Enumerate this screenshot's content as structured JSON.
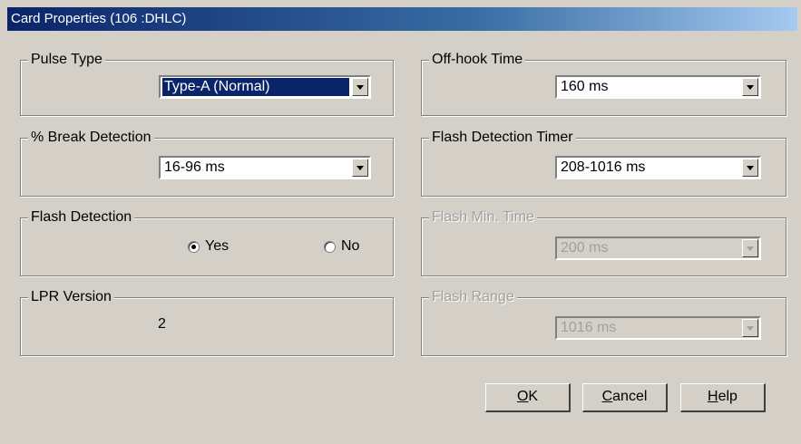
{
  "window": {
    "title": "Card Properties (106 :DHLC)"
  },
  "left": {
    "pulse_type": {
      "label": "Pulse Type",
      "value": "Type-A (Normal)"
    },
    "break_detection": {
      "label": "% Break Detection",
      "value": "16-96 ms"
    },
    "flash_detection": {
      "label": "Flash Detection",
      "yes": "Yes",
      "no": "No",
      "selected": "Yes"
    },
    "lpr_version": {
      "label": "LPR Version",
      "value": "2"
    }
  },
  "right": {
    "offhook_time": {
      "label": "Off-hook Time",
      "value": "160 ms"
    },
    "flash_detection_timer": {
      "label": "Flash Detection Timer",
      "value": "208-1016 ms"
    },
    "flash_min_time": {
      "label": "Flash Min. Time",
      "value": "200 ms",
      "disabled": true
    },
    "flash_range": {
      "label": "Flash Range",
      "value": "1016 ms",
      "disabled": true
    }
  },
  "buttons": {
    "ok": {
      "mnemonic": "O",
      "rest": "K"
    },
    "cancel": {
      "mnemonic": "C",
      "rest": "ancel"
    },
    "help": {
      "mnemonic": "H",
      "rest": "elp"
    }
  }
}
